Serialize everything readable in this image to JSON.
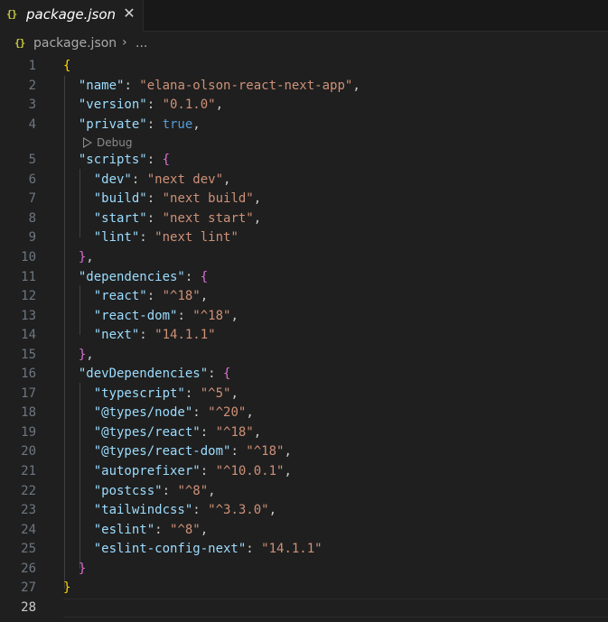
{
  "tab": {
    "icon": "{}",
    "label": "package.json",
    "close": "✕"
  },
  "breadcrumb": {
    "icon": "{}",
    "file": "package.json",
    "separator": "›",
    "more": "..."
  },
  "codelens": {
    "icon": "debug-run-icon",
    "label": "Debug"
  },
  "colors": {
    "background": "#1f1f1f",
    "key": "#9cdcfe",
    "string": "#ce9178",
    "boolean": "#569cd6",
    "bracket_level1": "#ffd700",
    "bracket_level2": "#da70d6",
    "json_icon": "#cbcb41"
  },
  "active_line": 28,
  "lines": [
    {
      "n": "1",
      "tokens": [
        {
          "t": "{",
          "c": "b1"
        }
      ]
    },
    {
      "n": "2",
      "tokens": [
        {
          "t": "  ",
          "c": "punc"
        },
        {
          "t": "\"name\"",
          "c": "key"
        },
        {
          "t": ": ",
          "c": "punc"
        },
        {
          "t": "\"elana-olson-react-next-app\"",
          "c": "str"
        },
        {
          "t": ",",
          "c": "punc"
        }
      ]
    },
    {
      "n": "3",
      "tokens": [
        {
          "t": "  ",
          "c": "punc"
        },
        {
          "t": "\"version\"",
          "c": "key"
        },
        {
          "t": ": ",
          "c": "punc"
        },
        {
          "t": "\"0.1.0\"",
          "c": "str"
        },
        {
          "t": ",",
          "c": "punc"
        }
      ]
    },
    {
      "n": "4",
      "tokens": [
        {
          "t": "  ",
          "c": "punc"
        },
        {
          "t": "\"private\"",
          "c": "key"
        },
        {
          "t": ": ",
          "c": "punc"
        },
        {
          "t": "true",
          "c": "bool"
        },
        {
          "t": ",",
          "c": "punc"
        }
      ]
    },
    {
      "n": "5",
      "tokens": [
        {
          "t": "  ",
          "c": "punc"
        },
        {
          "t": "\"scripts\"",
          "c": "key"
        },
        {
          "t": ": ",
          "c": "punc"
        },
        {
          "t": "{",
          "c": "b2"
        }
      ]
    },
    {
      "n": "6",
      "tokens": [
        {
          "t": "    ",
          "c": "punc"
        },
        {
          "t": "\"dev\"",
          "c": "key"
        },
        {
          "t": ": ",
          "c": "punc"
        },
        {
          "t": "\"next dev\"",
          "c": "str"
        },
        {
          "t": ",",
          "c": "punc"
        }
      ]
    },
    {
      "n": "7",
      "tokens": [
        {
          "t": "    ",
          "c": "punc"
        },
        {
          "t": "\"build\"",
          "c": "key"
        },
        {
          "t": ": ",
          "c": "punc"
        },
        {
          "t": "\"next build\"",
          "c": "str"
        },
        {
          "t": ",",
          "c": "punc"
        }
      ]
    },
    {
      "n": "8",
      "tokens": [
        {
          "t": "    ",
          "c": "punc"
        },
        {
          "t": "\"start\"",
          "c": "key"
        },
        {
          "t": ": ",
          "c": "punc"
        },
        {
          "t": "\"next start\"",
          "c": "str"
        },
        {
          "t": ",",
          "c": "punc"
        }
      ]
    },
    {
      "n": "9",
      "tokens": [
        {
          "t": "    ",
          "c": "punc"
        },
        {
          "t": "\"lint\"",
          "c": "key"
        },
        {
          "t": ": ",
          "c": "punc"
        },
        {
          "t": "\"next lint\"",
          "c": "str"
        }
      ]
    },
    {
      "n": "10",
      "tokens": [
        {
          "t": "  ",
          "c": "punc"
        },
        {
          "t": "}",
          "c": "b2"
        },
        {
          "t": ",",
          "c": "punc"
        }
      ]
    },
    {
      "n": "11",
      "tokens": [
        {
          "t": "  ",
          "c": "punc"
        },
        {
          "t": "\"dependencies\"",
          "c": "key"
        },
        {
          "t": ": ",
          "c": "punc"
        },
        {
          "t": "{",
          "c": "b2"
        }
      ]
    },
    {
      "n": "12",
      "tokens": [
        {
          "t": "    ",
          "c": "punc"
        },
        {
          "t": "\"react\"",
          "c": "key"
        },
        {
          "t": ": ",
          "c": "punc"
        },
        {
          "t": "\"^18\"",
          "c": "str"
        },
        {
          "t": ",",
          "c": "punc"
        }
      ]
    },
    {
      "n": "13",
      "tokens": [
        {
          "t": "    ",
          "c": "punc"
        },
        {
          "t": "\"react-dom\"",
          "c": "key"
        },
        {
          "t": ": ",
          "c": "punc"
        },
        {
          "t": "\"^18\"",
          "c": "str"
        },
        {
          "t": ",",
          "c": "punc"
        }
      ]
    },
    {
      "n": "14",
      "tokens": [
        {
          "t": "    ",
          "c": "punc"
        },
        {
          "t": "\"next\"",
          "c": "key"
        },
        {
          "t": ": ",
          "c": "punc"
        },
        {
          "t": "\"14.1.1\"",
          "c": "str"
        }
      ]
    },
    {
      "n": "15",
      "tokens": [
        {
          "t": "  ",
          "c": "punc"
        },
        {
          "t": "}",
          "c": "b2"
        },
        {
          "t": ",",
          "c": "punc"
        }
      ]
    },
    {
      "n": "16",
      "tokens": [
        {
          "t": "  ",
          "c": "punc"
        },
        {
          "t": "\"devDependencies\"",
          "c": "key"
        },
        {
          "t": ": ",
          "c": "punc"
        },
        {
          "t": "{",
          "c": "b2"
        }
      ]
    },
    {
      "n": "17",
      "tokens": [
        {
          "t": "    ",
          "c": "punc"
        },
        {
          "t": "\"typescript\"",
          "c": "key"
        },
        {
          "t": ": ",
          "c": "punc"
        },
        {
          "t": "\"^5\"",
          "c": "str"
        },
        {
          "t": ",",
          "c": "punc"
        }
      ]
    },
    {
      "n": "18",
      "tokens": [
        {
          "t": "    ",
          "c": "punc"
        },
        {
          "t": "\"@types/node\"",
          "c": "key"
        },
        {
          "t": ": ",
          "c": "punc"
        },
        {
          "t": "\"^20\"",
          "c": "str"
        },
        {
          "t": ",",
          "c": "punc"
        }
      ]
    },
    {
      "n": "19",
      "tokens": [
        {
          "t": "    ",
          "c": "punc"
        },
        {
          "t": "\"@types/react\"",
          "c": "key"
        },
        {
          "t": ": ",
          "c": "punc"
        },
        {
          "t": "\"^18\"",
          "c": "str"
        },
        {
          "t": ",",
          "c": "punc"
        }
      ]
    },
    {
      "n": "20",
      "tokens": [
        {
          "t": "    ",
          "c": "punc"
        },
        {
          "t": "\"@types/react-dom\"",
          "c": "key"
        },
        {
          "t": ": ",
          "c": "punc"
        },
        {
          "t": "\"^18\"",
          "c": "str"
        },
        {
          "t": ",",
          "c": "punc"
        }
      ]
    },
    {
      "n": "21",
      "tokens": [
        {
          "t": "    ",
          "c": "punc"
        },
        {
          "t": "\"autoprefixer\"",
          "c": "key"
        },
        {
          "t": ": ",
          "c": "punc"
        },
        {
          "t": "\"^10.0.1\"",
          "c": "str"
        },
        {
          "t": ",",
          "c": "punc"
        }
      ]
    },
    {
      "n": "22",
      "tokens": [
        {
          "t": "    ",
          "c": "punc"
        },
        {
          "t": "\"postcss\"",
          "c": "key"
        },
        {
          "t": ": ",
          "c": "punc"
        },
        {
          "t": "\"^8\"",
          "c": "str"
        },
        {
          "t": ",",
          "c": "punc"
        }
      ]
    },
    {
      "n": "23",
      "tokens": [
        {
          "t": "    ",
          "c": "punc"
        },
        {
          "t": "\"tailwindcss\"",
          "c": "key"
        },
        {
          "t": ": ",
          "c": "punc"
        },
        {
          "t": "\"^3.3.0\"",
          "c": "str"
        },
        {
          "t": ",",
          "c": "punc"
        }
      ]
    },
    {
      "n": "24",
      "tokens": [
        {
          "t": "    ",
          "c": "punc"
        },
        {
          "t": "\"eslint\"",
          "c": "key"
        },
        {
          "t": ": ",
          "c": "punc"
        },
        {
          "t": "\"^8\"",
          "c": "str"
        },
        {
          "t": ",",
          "c": "punc"
        }
      ]
    },
    {
      "n": "25",
      "tokens": [
        {
          "t": "    ",
          "c": "punc"
        },
        {
          "t": "\"eslint-config-next\"",
          "c": "key"
        },
        {
          "t": ": ",
          "c": "punc"
        },
        {
          "t": "\"14.1.1\"",
          "c": "str"
        }
      ]
    },
    {
      "n": "26",
      "tokens": [
        {
          "t": "  ",
          "c": "punc"
        },
        {
          "t": "}",
          "c": "b2"
        }
      ]
    },
    {
      "n": "27",
      "tokens": [
        {
          "t": "}",
          "c": "b1"
        }
      ]
    },
    {
      "n": "28",
      "tokens": []
    }
  ]
}
